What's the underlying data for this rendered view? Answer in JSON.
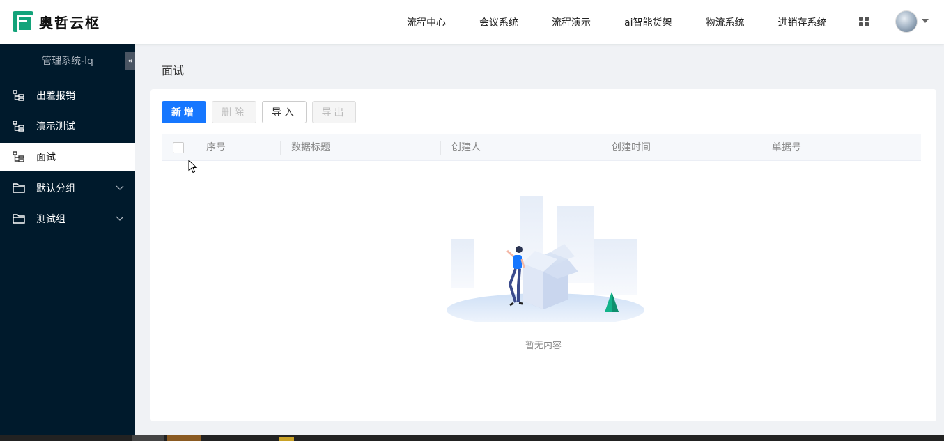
{
  "header": {
    "logo_text": "奥哲云枢",
    "nav": [
      "流程中心",
      "会议系统",
      "流程演示",
      "ai智能货架",
      "物流系统",
      "进销存系统"
    ]
  },
  "sidebar": {
    "system_title": "管理系统-lq",
    "collapse_glyph": "«",
    "items": [
      {
        "label": "出差报销",
        "icon": "tree-icon"
      },
      {
        "label": "演示测试",
        "icon": "tree-icon"
      },
      {
        "label": "面试",
        "icon": "tree-icon",
        "active": true
      },
      {
        "label": "默认分组",
        "icon": "folder-icon",
        "expandable": true
      },
      {
        "label": "测试组",
        "icon": "folder-icon",
        "expandable": true
      }
    ]
  },
  "main": {
    "page_title": "面试",
    "toolbar": {
      "add_label": "新增",
      "delete_label": "删除",
      "import_label": "导入",
      "export_label": "导出"
    },
    "table": {
      "columns": [
        "序号",
        "数据标题",
        "创建人",
        "创建时间",
        "单据号"
      ]
    },
    "empty_text": "暂无内容"
  },
  "colors": {
    "primary": "#1677ff",
    "sidebar_bg": "#001a2c",
    "logo_green": "#13a37a"
  }
}
